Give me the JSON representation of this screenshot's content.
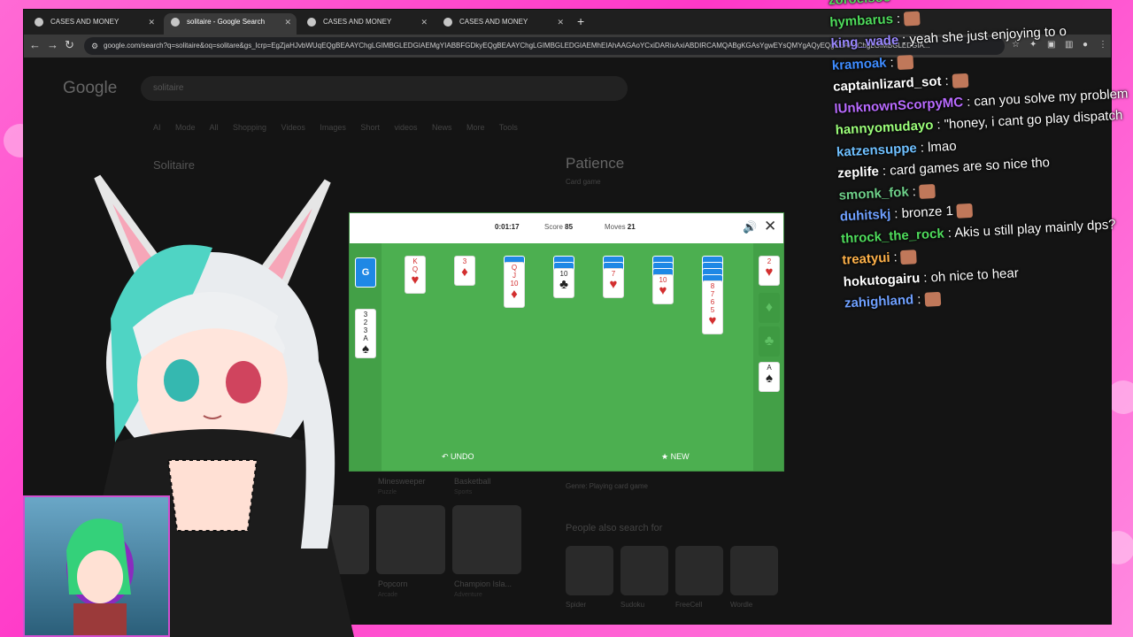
{
  "browser": {
    "tabs": [
      {
        "title": "CASES AND MONEY",
        "active": false
      },
      {
        "title": "solitaire - Google Search",
        "active": true
      },
      {
        "title": "CASES AND MONEY",
        "active": false
      },
      {
        "title": "CASES AND MONEY",
        "active": false
      }
    ],
    "new_tab": "+",
    "url": "google.com/search?q=solitaire&oq=solitare&gs_lcrp=EgZjaHJvbWUqEQgBEAAYChgLGIMBGLEDGIAEMgYIABBFGDkyEQgBEAAYChgLGIMBGLEDGIAEMhEIAhAAGAoYCxiDARixAxiABDIRCAMQABgKGAsYgwEYsQMYgAQyEQgEEAAYChgLGIMBGLEDGIA..."
  },
  "google": {
    "logo": "Google",
    "query": "solitaire",
    "tabs": "AI Mode All Shopping Videos Images Short videos News More Tools",
    "section_title": "Solitaire",
    "panel_title": "Patience",
    "panel_sub": "Card game",
    "genre": "Genre: Playing card game",
    "people_also": "People also search for",
    "related": [
      "Spider",
      "Sudoku",
      "FreeCell",
      "Wordle"
    ],
    "bottom_games": [
      {
        "name": "Minesweeper",
        "sub": "Puzzle"
      },
      {
        "name": "Basketball",
        "sub": "Sports"
      },
      {
        "name": "Popcorn",
        "sub": "Arcade"
      },
      {
        "name": "Champion Isla...",
        "sub": "Adventure"
      }
    ]
  },
  "solitaire": {
    "timer": "0:01:17",
    "score_label": "Score",
    "score": "85",
    "moves_label": "Moves",
    "moves": "21",
    "undo": "UNDO",
    "new": "NEW",
    "stock_logo": "G",
    "waste": [
      "3",
      "2",
      "3",
      "A"
    ],
    "tableau_tops": [
      {
        "rank": "K",
        "rank2": "Q",
        "suit": "♥",
        "red": true
      },
      {
        "rank": "3",
        "suit": "♦",
        "red": true
      },
      {
        "rank": "Q",
        "rank2": "J",
        "rank3": "10",
        "suit": "♦",
        "red": true
      },
      {
        "rank": "10",
        "suit": "♣",
        "red": false
      },
      {
        "rank": "7",
        "suit": "♥",
        "red": true
      },
      {
        "rank": "10",
        "suit": "♥",
        "red": true
      },
      {
        "rank": "8",
        "rank2": "7",
        "rank3": "6",
        "rank4": "5",
        "suit": "♥",
        "red": true
      }
    ],
    "foundations": [
      {
        "rank": "2",
        "suit": "♥",
        "red": true
      },
      {
        "rank": "",
        "suit": "♦",
        "red": false
      },
      {
        "rank": "",
        "suit": "♣",
        "red": false
      },
      {
        "rank": "A",
        "suit": "♠",
        "red": false
      }
    ]
  },
  "chat": [
    {
      "user": "zoroelsoe",
      "color": "#4fdc5c",
      "text": ""
    },
    {
      "user": "hymbarus",
      "color": "#4fdc5c",
      "text": ":"
    },
    {
      "user": "king_wade",
      "color": "#9a88ff",
      "text": ": yeah she just enjoying to o"
    },
    {
      "user": "kramoak",
      "color": "#3f8cff",
      "text": ":"
    },
    {
      "user": "captainlizard_sot",
      "color": "#ffffff",
      "text": ":"
    },
    {
      "user": "lUnknownScorpyMC",
      "color": "#b96bff",
      "text": ": can you solve my problem"
    },
    {
      "user": "hannyomudayo",
      "color": "#9cff7a",
      "text": ": \"honey, i cant go play dispatch"
    },
    {
      "user": "katzensuppe",
      "color": "#6fc0ff",
      "text": ": lmao"
    },
    {
      "user": "zeplife",
      "color": "#ffffff",
      "text": ": card games are so nice tho"
    },
    {
      "user": "smonk_fok",
      "color": "#6fd18a",
      "text": ":"
    },
    {
      "user": "duhitskj",
      "color": "#6fa0ff",
      "text": ": bronze 1"
    },
    {
      "user": "throck_the_rock",
      "color": "#4fdc5c",
      "text": ": Akis u still play mainly dps?"
    },
    {
      "user": "treatyui",
      "color": "#ffb24a",
      "text": ":"
    },
    {
      "user": "hokutogairu",
      "color": "#ffffff",
      "text": ": oh nice to hear"
    },
    {
      "user": "zahighland",
      "color": "#6fa0ff",
      "text": ":"
    }
  ],
  "colors": {
    "frame": "#ff38c8",
    "felt": "#4caf50",
    "card_back": "#1e88e5"
  }
}
